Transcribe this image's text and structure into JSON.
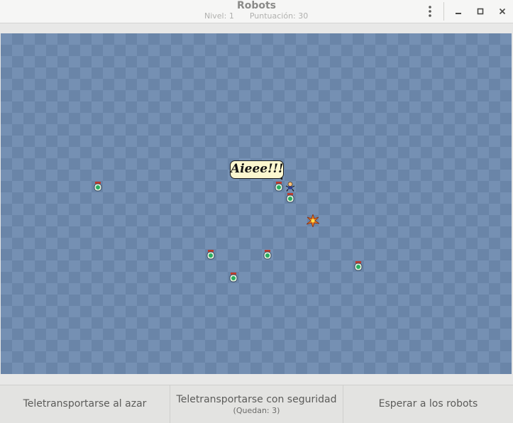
{
  "window": {
    "title": "Robots",
    "level": "Nivel: 1",
    "score": "Puntuación: 30"
  },
  "game": {
    "speech": "Aieee!!!",
    "robot_icon": "robot-icon",
    "player_icon": "player-icon",
    "debris_icon": "debris-icon"
  },
  "buttons": {
    "random_teleport": "Teletransportarse al azar",
    "safe_teleport": "Teletransportarse con seguridad",
    "safe_teleport_remaining": "(Quedan: 3)",
    "wait": "Esperar a los robots"
  },
  "colors": {
    "board_light": "#7590b3",
    "board_dark": "#6a85a8",
    "bubble": "#fbf7cf"
  }
}
